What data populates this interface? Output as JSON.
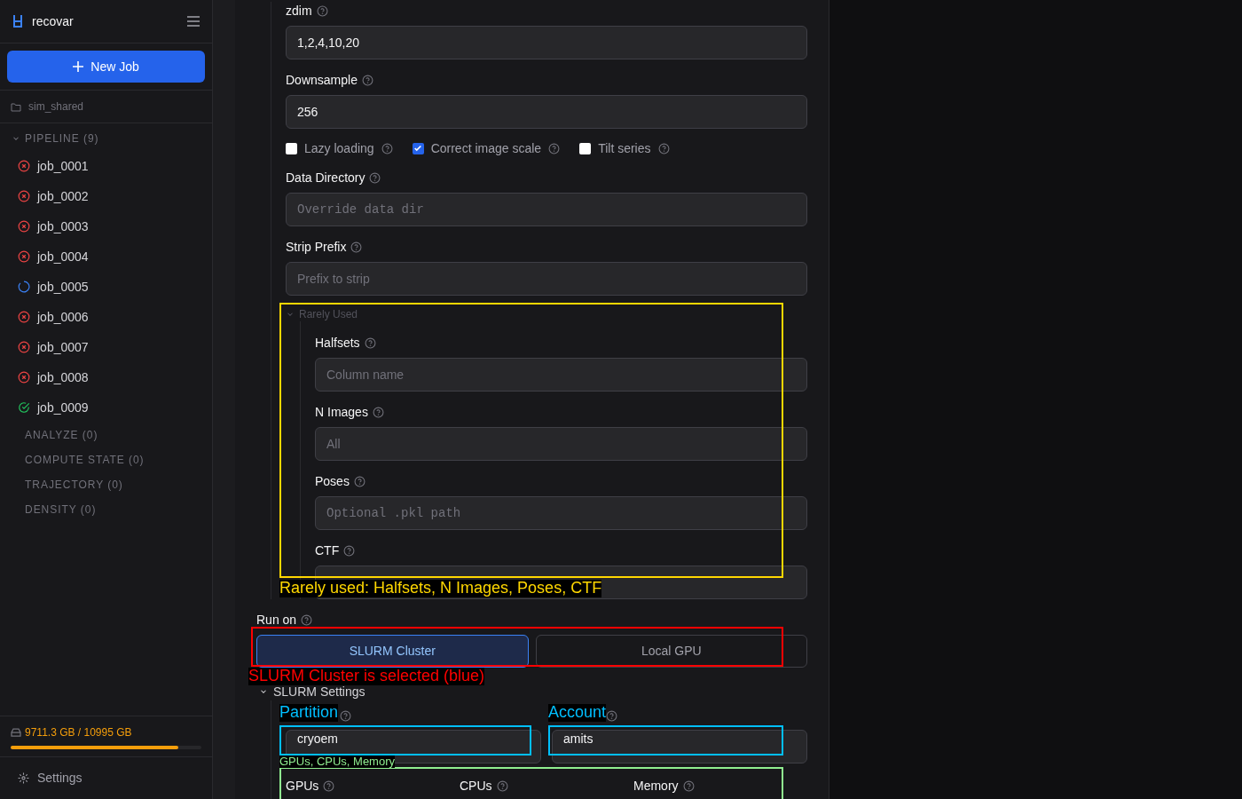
{
  "sidebar": {
    "app_name": "recovar",
    "new_job_button": "New Job",
    "project": "sim_shared",
    "groups": [
      {
        "label": "PIPELINE (9)",
        "jobs": [
          {
            "name": "job_0001",
            "kind": "failed"
          },
          {
            "name": "job_0002",
            "kind": "failed"
          },
          {
            "name": "job_0003",
            "kind": "failed"
          },
          {
            "name": "job_0004",
            "kind": "failed"
          },
          {
            "name": "job_0005",
            "kind": "running"
          },
          {
            "name": "job_0006",
            "kind": "failed"
          },
          {
            "name": "job_0007",
            "kind": "failed"
          },
          {
            "name": "job_0008",
            "kind": "failed"
          },
          {
            "name": "job_0009",
            "kind": "done"
          }
        ]
      },
      {
        "label": "ANALYZE (0)"
      },
      {
        "label": "COMPUTE STATE (0)"
      },
      {
        "label": "TRAJECTORY (0)"
      },
      {
        "label": "DENSITY (0)"
      }
    ],
    "storage": {
      "reading": "9711.3 GB / 10995 GB",
      "level": 0.88
    },
    "settings": "Settings"
  },
  "form": {
    "fields": [
      {
        "kind": "input",
        "label": "zdim",
        "value": "1,2,4,10,20"
      },
      {
        "kind": "input",
        "label": "Downsample",
        "value": "256"
      },
      {
        "kind": "checkboxes",
        "options": [
          {
            "label": "Lazy loading",
            "checked": false
          },
          {
            "label": "Correct image scale",
            "checked": true
          },
          {
            "label": "Tilt series",
            "checked": false
          }
        ]
      },
      {
        "kind": "path",
        "label": "Data Directory",
        "placeholder": "Override data dir"
      },
      {
        "kind": "input",
        "label": "Strip Prefix",
        "placeholder": "Prefix to strip"
      }
    ],
    "rarely_used": {
      "label": "Rarely Used",
      "fields": [
        {
          "kind": "input",
          "label": "Halfsets",
          "placeholder": "Column name"
        },
        {
          "kind": "input",
          "label": "N Images",
          "placeholder": "All"
        },
        {
          "kind": "path",
          "label": "Poses",
          "placeholder": "Optional .pkl path"
        },
        {
          "kind": "path",
          "label": "CTF"
        }
      ]
    },
    "run_on": {
      "label": "Run on",
      "options": [
        {
          "label": "SLURM Cluster",
          "selected": true
        },
        {
          "label": "Local GPU",
          "selected": false
        }
      ]
    },
    "slurm": {
      "label": "SLURM Settings",
      "partition_value": "cryoem",
      "account_value": "amits",
      "resources": [
        "GPUs",
        "CPUs",
        "Memory"
      ]
    }
  },
  "annotations": [
    {
      "text": "Rarely used: Halfsets, N Images, Poses, CTF",
      "color": "#ffd700"
    },
    {
      "text": "SLURM Cluster is selected (blue)",
      "color": "#ff0000"
    },
    {
      "text": "Partition",
      "color": "#00bfff"
    },
    {
      "text": "Account",
      "color": "#00bfff"
    },
    {
      "text": "GPUs, CPUs, Memory",
      "color": "#90ee90"
    }
  ]
}
